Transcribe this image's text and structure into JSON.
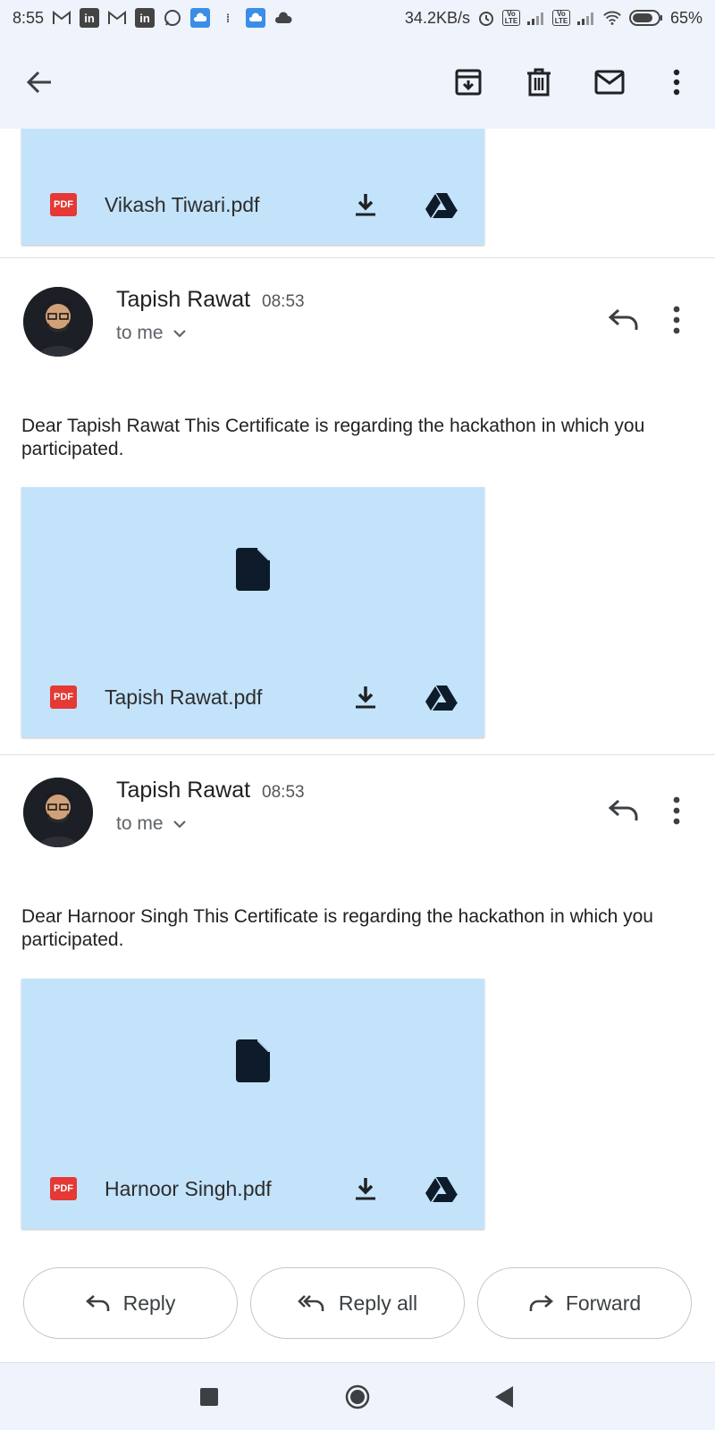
{
  "status_bar": {
    "time": "8:55",
    "network_speed": "34.2KB/s",
    "battery": "65%",
    "volte_label": "Vo LTE"
  },
  "toolbar": {
    "back": "back-arrow-icon",
    "archive": "archive-icon",
    "delete": "trash-icon",
    "mark_unread": "mail-icon",
    "more": "more-vert-icon"
  },
  "attachments": [
    {
      "badge": "PDF",
      "file_name": "Vikash Tiwari.pdf"
    }
  ],
  "messages": [
    {
      "sender": "Tapish Rawat",
      "time": "08:53",
      "recipient": "to me",
      "body": "Dear Tapish Rawat This Certificate is regarding the hackathon in which you participated.",
      "attachment": {
        "badge": "PDF",
        "file_name": "Tapish Rawat.pdf"
      }
    },
    {
      "sender": "Tapish Rawat",
      "time": "08:53",
      "recipient": "to me",
      "body": "Dear Harnoor Singh This Certificate is regarding the hackathon in which you participated.",
      "attachment": {
        "badge": "PDF",
        "file_name": "Harnoor Singh.pdf"
      }
    }
  ],
  "actions": {
    "reply": "Reply",
    "reply_all": "Reply all",
    "forward": "Forward"
  },
  "colors": {
    "attachment_bg": "#c3e3fb",
    "pdf_badge": "#e53935",
    "bar_bg": "#eff3fb"
  }
}
